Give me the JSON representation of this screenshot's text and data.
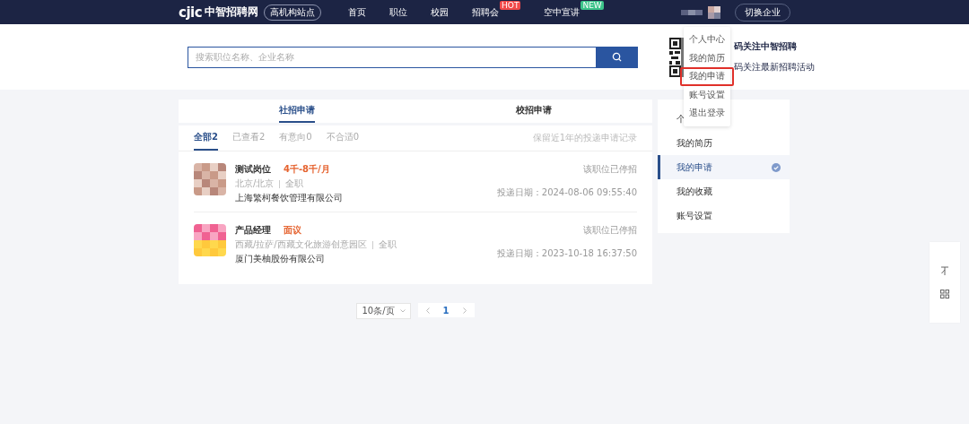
{
  "header": {
    "logo": "cjic",
    "site_name": "中智招聘网",
    "site_badge": "高机构站点",
    "nav": [
      {
        "label": "首页"
      },
      {
        "label": "职位"
      },
      {
        "label": "校园"
      },
      {
        "label": "招聘会",
        "badge": {
          "text": "HOT",
          "color": "#f04a4a"
        }
      },
      {
        "label": "空中宣讲",
        "badge": {
          "text": "NEW",
          "color": "#3cc48a"
        }
      }
    ],
    "switch_button": "切换企业"
  },
  "search": {
    "placeholder": "搜索职位名称、企业名称"
  },
  "qr_promo": {
    "lines": [
      "码关注中智招聘",
      "码关注最新招聘活动"
    ]
  },
  "user_menu": {
    "items": [
      {
        "label": "个人中心",
        "selected": false
      },
      {
        "label": "我的简历",
        "selected": false
      },
      {
        "label": "我的申请",
        "selected": true
      },
      {
        "label": "账号设置",
        "selected": false
      },
      {
        "label": "退出登录",
        "selected": false
      }
    ]
  },
  "apply_tabs": [
    {
      "label": "社招申请",
      "selected": true
    },
    {
      "label": "校招申请",
      "selected": false
    }
  ],
  "filters": [
    {
      "label": "全部2",
      "selected": true
    },
    {
      "label": "已查看2",
      "selected": false
    },
    {
      "label": "有意向0",
      "selected": false
    },
    {
      "label": "不合适0",
      "selected": false
    }
  ],
  "filter_note": "保留近1年的投递申请记录",
  "applications": [
    {
      "title": "测试岗位",
      "salary": "4千-8千/月",
      "location": "北京/北京",
      "job_type": "全职",
      "company": "上海繁柯餐饮管理有限公司",
      "status": "该职位已停招",
      "date": "投递日期：2024-08-06 09:55:40"
    },
    {
      "title": "产品经理",
      "salary": "面议",
      "location": "西藏/拉萨/西藏文化旅游创意园区",
      "job_type": "全职",
      "company": "厦门美柚股份有限公司",
      "status": "该职位已停招",
      "date": "投递日期：2023-10-18 16:37:50"
    }
  ],
  "pagination": {
    "page_size": "10条/页",
    "pages": [
      {
        "label": "1",
        "selected": true
      }
    ]
  },
  "side_menu": [
    {
      "label": "个",
      "selected": false
    },
    {
      "label": "我的简历",
      "selected": false
    },
    {
      "label": "我的申请",
      "selected": true
    },
    {
      "label": "我的收藏",
      "selected": false
    },
    {
      "label": "账号设置",
      "selected": false
    }
  ]
}
